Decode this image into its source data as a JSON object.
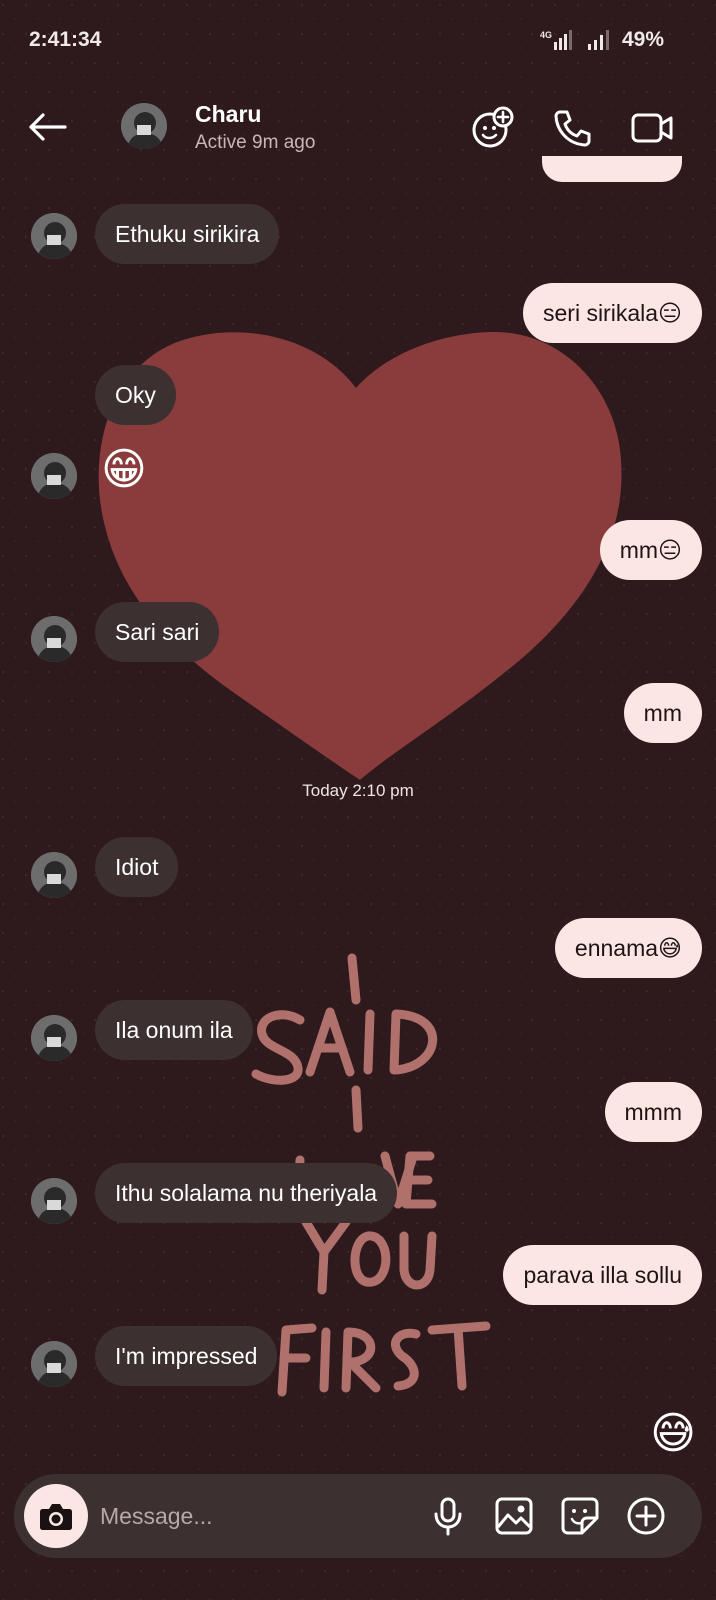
{
  "status_bar": {
    "time": "2:41:34",
    "network_label": "4G",
    "battery": "49%"
  },
  "header": {
    "name": "Charu",
    "status": "Active 9m ago",
    "icons": [
      "back-arrow-icon",
      "effects-icon",
      "phone-icon",
      "video-icon"
    ]
  },
  "messages": [
    {
      "dir": "in",
      "text": "Ethuku sirikira",
      "avatar": true
    },
    {
      "dir": "out",
      "text": "seri sirikala😑"
    },
    {
      "dir": "in",
      "text": "Oky",
      "avatar": false
    },
    {
      "dir": "in",
      "text": "😁",
      "avatar": true,
      "emoji_only": true
    },
    {
      "dir": "out",
      "text": "mm😑"
    },
    {
      "dir": "in",
      "text": "Sari sari",
      "avatar": true
    },
    {
      "dir": "out",
      "text": "mm"
    },
    {
      "dir": "in",
      "text": "Idiot",
      "avatar": true
    },
    {
      "dir": "out",
      "text": "ennama😅"
    },
    {
      "dir": "in",
      "text": "Ila onum ila",
      "avatar": true
    },
    {
      "dir": "out",
      "text": "mmm"
    },
    {
      "dir": "in",
      "text": "Ithu solalama nu theriyala",
      "avatar": true
    },
    {
      "dir": "out",
      "text": "parava illa sollu"
    },
    {
      "dir": "in",
      "text": "I'm impressed",
      "avatar": true
    },
    {
      "dir": "out",
      "text": "😅",
      "emoji_only": true
    }
  ],
  "timestamp": "Today 2:10 pm",
  "background_text": {
    "line1": "I",
    "line2": "SAID",
    "line3": "I",
    "line4": "LOVE",
    "line5": "YOU",
    "line6": "FIRST"
  },
  "composer": {
    "placeholder": "Message...",
    "icons": [
      "camera-icon",
      "microphone-icon",
      "gallery-icon",
      "sticker-icon",
      "add-icon"
    ]
  },
  "colors": {
    "background": "#2e1a1c",
    "heart": "#8a3b3c",
    "incoming_bubble": "#3d3030",
    "outgoing_bubble": "#fbe6e4",
    "bg_text": "#b0706c"
  }
}
